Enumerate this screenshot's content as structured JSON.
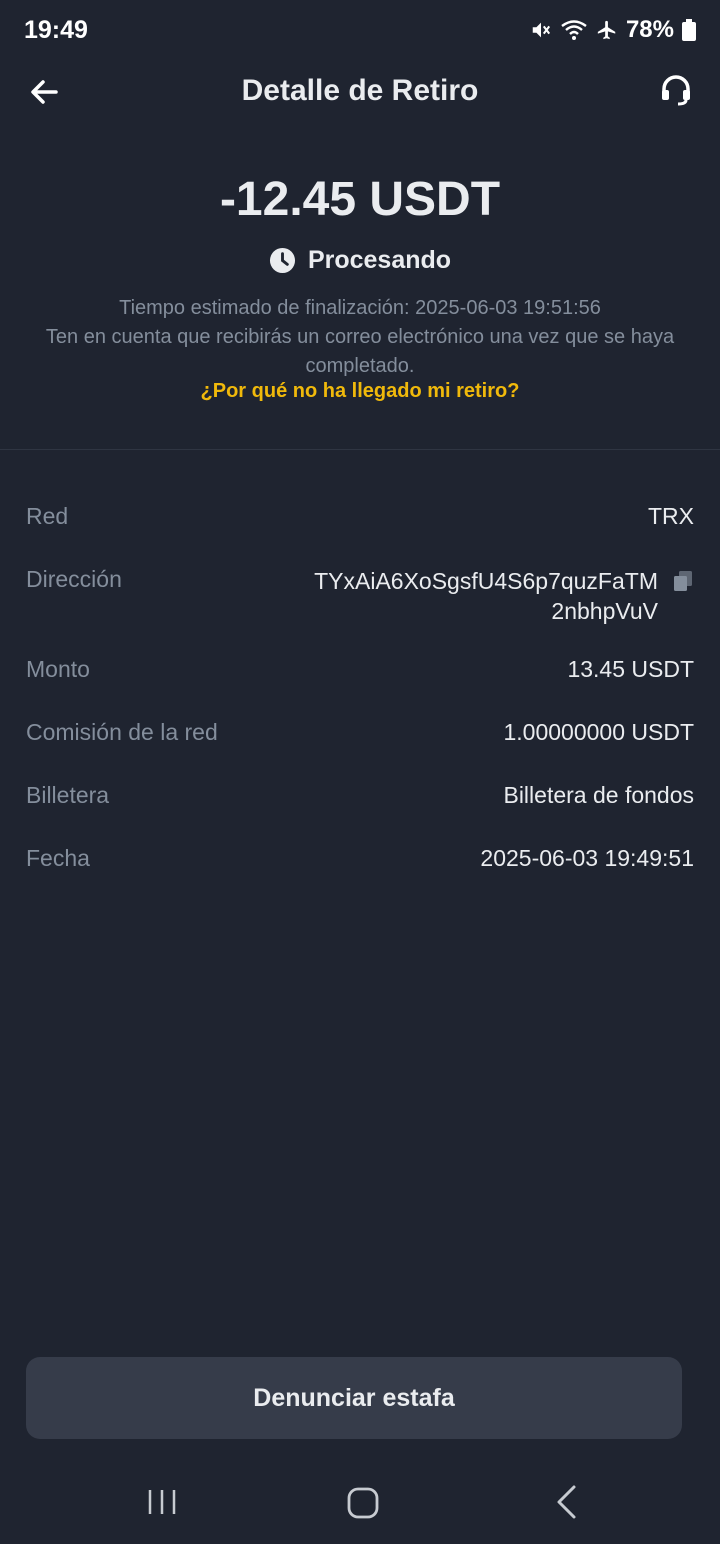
{
  "status_bar": {
    "time": "19:49",
    "battery_percent": "78%",
    "icons": [
      "mute-icon",
      "wifi-icon",
      "airplane-icon",
      "battery-icon"
    ]
  },
  "header": {
    "title": "Detalle de Retiro",
    "back_icon": "arrow-left-icon",
    "support_icon": "headset-icon"
  },
  "summary": {
    "amount": "-12.45 USDT",
    "status": "Procesando",
    "status_icon": "clock-icon",
    "eta_line": "Tiempo estimado de finalización: 2025-06-03 19:51:56",
    "email_notice": "Ten en cuenta que recibirás un correo electrónico una vez que se haya completado.",
    "why_link": "¿Por qué no ha llegado mi retiro?"
  },
  "details": {
    "network": {
      "label": "Red",
      "value": "TRX"
    },
    "address": {
      "label": "Dirección",
      "value": "TYxAiA6XoSgsfU4S6p7quzFaTM2nbhpVuV"
    },
    "amount": {
      "label": "Monto",
      "value": "13.45 USDT"
    },
    "fee": {
      "label": "Comisión de la red",
      "value": "1.00000000 USDT"
    },
    "wallet": {
      "label": "Billetera",
      "value": "Billetera de fondos"
    },
    "date": {
      "label": "Fecha",
      "value": "2025-06-03 19:49:51"
    }
  },
  "actions": {
    "report_scam": "Denunciar estafa"
  },
  "colors": {
    "background": "#1f2430",
    "accent": "#f0b90b",
    "muted_text": "#848e9c",
    "primary_text": "#eaecef",
    "button_bg": "#363c4a"
  }
}
